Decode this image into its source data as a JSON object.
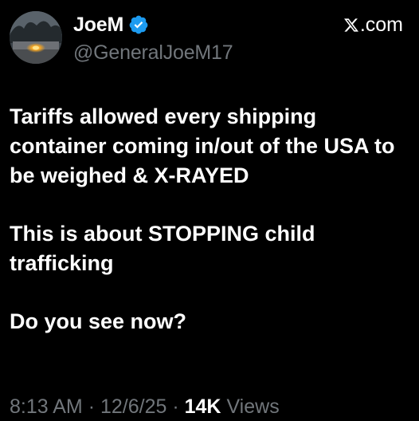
{
  "author": {
    "display_name": "JoeM",
    "handle": "@GeneralJoeM17",
    "verified": true,
    "avatar_icon": "avatar-photo"
  },
  "source": {
    "icon": "x-logo-icon",
    "label": ".com"
  },
  "tweet": {
    "paragraphs": [
      "Tariffs allowed every shipping container coming in/out of the USA to be weighed & X-RAYED",
      "This is about STOPPING child trafficking",
      "Do you see now?"
    ]
  },
  "meta": {
    "time": "8:13 AM",
    "separator": "·",
    "date": "12/6/25",
    "views_count": "14K",
    "views_label": "Views"
  },
  "colors": {
    "background": "#000000",
    "text": "#ffffff",
    "secondary": "#71767b",
    "verified": "#1d9bf0"
  }
}
